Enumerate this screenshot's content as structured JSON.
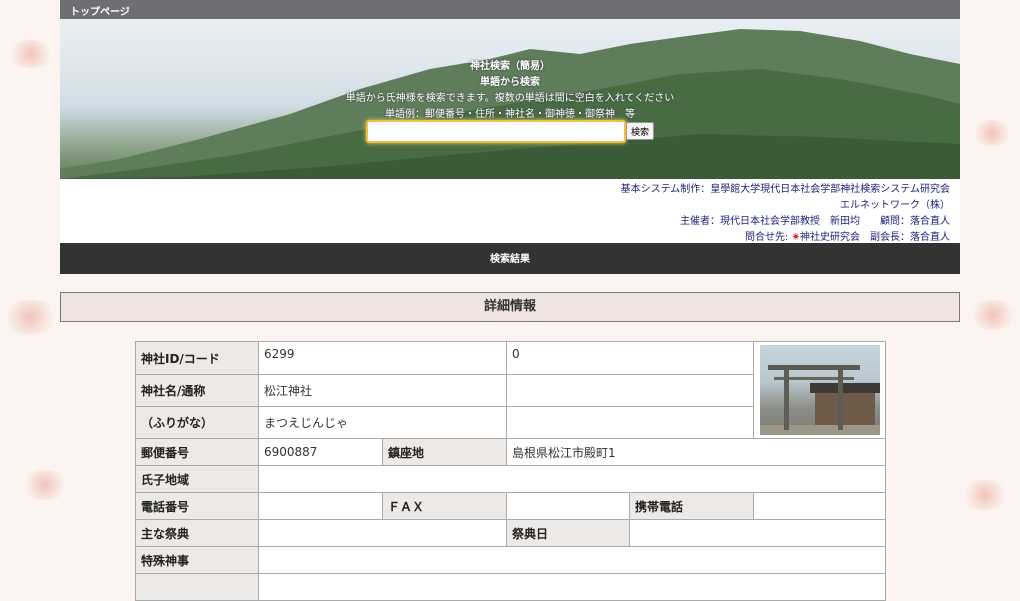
{
  "nav": {
    "top_page": "トップページ"
  },
  "hero": {
    "title": "神社検索（簡易）",
    "subtitle": "単語から検索",
    "description": "単語から氏神様を検索できます。複数の単語は間に空白を入れてください",
    "example": "単語例：郵便番号・住所・神社名・御神徳・御祭神　等",
    "search_value": "",
    "search_button": "検索"
  },
  "credits": {
    "line1": "基本システム制作：皇學館大学現代日本社会学部神社検索システム研究会",
    "line2": "エルネットワーク（株）",
    "line3": "主催者：現代日本社会学部教授　新田均　　顧問：落合直人",
    "contact_label": "問合せ先:",
    "contact_org": "神社史研究会",
    "contact_rest": "　副会長：落合直人"
  },
  "result_bar": "検索結果",
  "detail_heading": "詳細情報",
  "detail": {
    "labels": {
      "id_code": "神社ID/コード",
      "name": "神社名/通称",
      "furigana": "（ふりがな）",
      "postal": "郵便番号",
      "location": "鎮座地",
      "ujiko": "氏子地域",
      "phone": "電話番号",
      "fax": "ＦＡＸ",
      "mobile": "携帯電話",
      "festival": "主な祭典",
      "festival_day": "祭典日",
      "special": "特殊神事"
    },
    "values": {
      "id": "6299",
      "code": "0",
      "name": "松江神社",
      "furigana": "まつえじんじゃ",
      "postal": "6900887",
      "location": "島根県松江市殿町1"
    }
  },
  "colors": {
    "topbar": "#6e6e74",
    "result_bar": "#333333",
    "header_cell": "#ece9e6",
    "link": "#22227a"
  }
}
